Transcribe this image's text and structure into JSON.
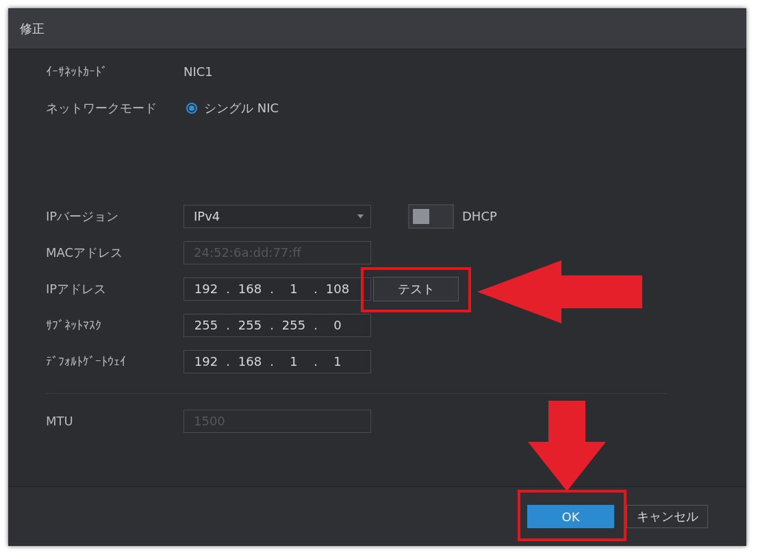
{
  "window": {
    "title": "修正"
  },
  "rows": [
    {
      "kind": "text",
      "label": "ｲｰｻﾈｯﾄｶｰﾄﾞ",
      "value": "NIC1"
    },
    {
      "kind": "radio",
      "label": "ネットワークモード",
      "option": "シングル NIC",
      "selected": true
    },
    {
      "kind": "select",
      "label": "IPバージョン",
      "value": "IPv4",
      "toggle": {
        "label": "DHCP",
        "on": false
      }
    },
    {
      "kind": "input",
      "label": "MACアドレス",
      "value": "24:52:6a:dd:77:ff",
      "disabled": true
    },
    {
      "kind": "ip",
      "label": "IPアドレス",
      "octets": [
        "192",
        "168",
        "1",
        "108"
      ],
      "separator": ".",
      "button": "テスト"
    },
    {
      "kind": "ip",
      "label": "ｻﾌﾞﾈｯﾄﾏｽｸ",
      "octets": [
        "255",
        "255",
        "255",
        "0"
      ],
      "separator": "."
    },
    {
      "kind": "ip",
      "label": "ﾃﾞﾌｫﾙﾄｹﾞｰﾄｳｪｲ",
      "octets": [
        "192",
        "168",
        "1",
        "1"
      ],
      "separator": "."
    },
    {
      "kind": "divider"
    },
    {
      "kind": "input",
      "label": "MTU",
      "value": "1500",
      "disabled": true
    }
  ],
  "buttons": [
    {
      "label": "OK",
      "primary": true
    },
    {
      "label": "キャンセル",
      "primary": false
    }
  ]
}
